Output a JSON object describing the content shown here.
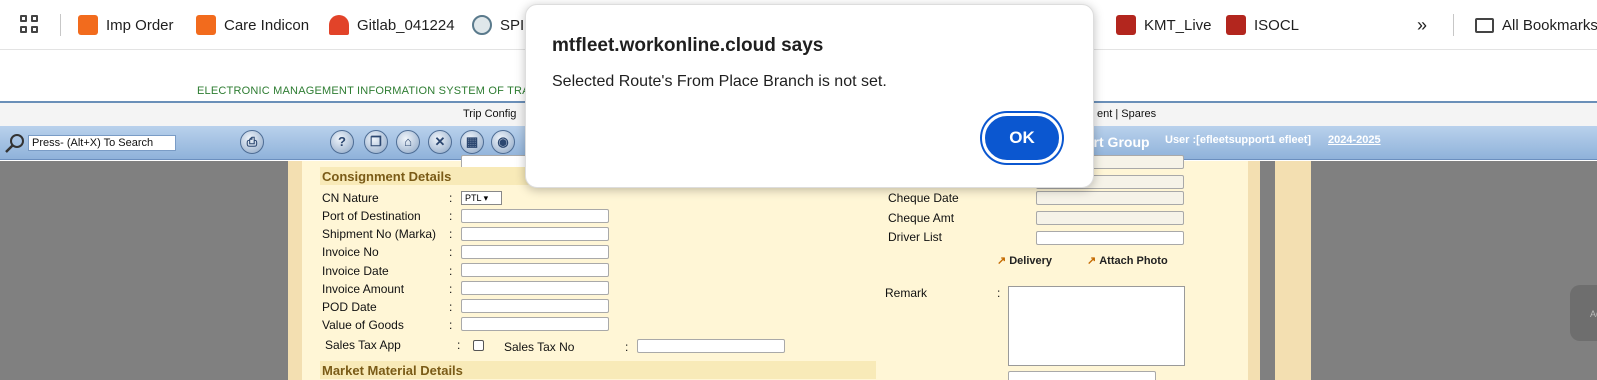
{
  "bookmarks_bar": {
    "items": [
      {
        "label": "Imp Order",
        "icon": "orange-chart-icon",
        "color": "#f26b1d"
      },
      {
        "label": "Care Indicon",
        "icon": "orange-chart-icon",
        "color": "#f26b1d"
      },
      {
        "label": "Gitlab_041224",
        "icon": "gitlab-icon",
        "color": "#e24329"
      },
      {
        "label": "SPI",
        "icon": "spiral-icon",
        "color": "#5a7a8c"
      },
      {
        "label": "KMT_Live",
        "icon": "truck-icon",
        "color": "#b3261e"
      },
      {
        "label": "ISOCL",
        "icon": "truck-icon",
        "color": "#b3261e"
      }
    ],
    "overflow": "»",
    "all_bookmarks": "All Bookmarks"
  },
  "app": {
    "banner": "ELECTRONIC MANAGEMENT INFORMATION SYSTEM OF TRA",
    "menu_left": "Trip Config",
    "menu_right": "ent | Spares",
    "search_placeholder": "Press- (Alt+X) To Search",
    "group_label": "ort Group",
    "user_label": "User :[efleetsupport1 efleet]",
    "year": "2024-2025",
    "accent_color": "#0b57d0"
  },
  "form": {
    "consignment_header": "Consignment Details",
    "fields": [
      {
        "label": "CN Nature",
        "type": "select",
        "value": "PTL"
      },
      {
        "label": "Port of Destination",
        "type": "text",
        "value": ""
      },
      {
        "label": "Shipment No (Marka)",
        "type": "text",
        "value": ""
      },
      {
        "label": "Invoice No",
        "type": "text",
        "value": ""
      },
      {
        "label": "Invoice Date",
        "type": "text",
        "value": ""
      },
      {
        "label": "Invoice Amount",
        "type": "text",
        "value": ""
      },
      {
        "label": "POD Date",
        "type": "text",
        "value": ""
      },
      {
        "label": "Value of Goods",
        "type": "text",
        "value": ""
      }
    ],
    "sales_tax_app": "Sales Tax App",
    "sales_tax_no": "Sales Tax No",
    "market_header": "Market Material Details",
    "right_fields": [
      "Cheque Date",
      "Cheque Amt",
      "Driver List"
    ],
    "delivery_link": "Delivery",
    "attach_link": "Attach Photo",
    "remark": "Remark"
  },
  "dialog": {
    "title": "mtfleet.workonline.cloud says",
    "message": "Selected Route's From Place Branch is not set.",
    "ok_label": "OK"
  }
}
